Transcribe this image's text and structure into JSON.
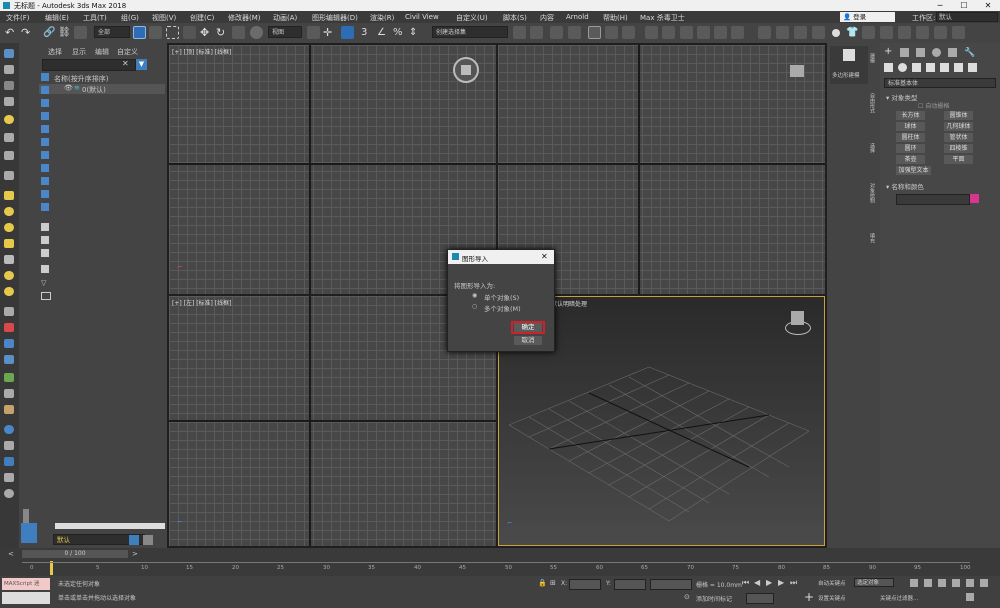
{
  "window": {
    "title": "无标题 - Autodesk 3ds Max 2018",
    "minimize": "─",
    "maximize": "☐",
    "close": "✕"
  },
  "menu": [
    "文件(F)",
    "编辑(E)",
    "工具(T)",
    "组(G)",
    "视图(V)",
    "创建(C)",
    "修改器(M)",
    "动画(A)",
    "图形编辑器(D)",
    "渲染(R)",
    "Civil View",
    "自定义(U)",
    "脚本(S)",
    "内容",
    "Arnold",
    "帮助(H)",
    "Max 杀毒卫士"
  ],
  "account": {
    "login": "登录",
    "workspace_label": "工作区:",
    "workspace_value": "默认"
  },
  "toolbar": {
    "filter_all": "全部",
    "ref_coord": "视图",
    "selection_set": "创建选择集"
  },
  "explorer": {
    "tabs": [
      "选择",
      "显示",
      "编辑",
      "自定义"
    ],
    "column_header": "名称(按升序排序)",
    "root_item": "0(默认)",
    "layer_label": "默认"
  },
  "viewports": {
    "top_left": "[+] [顶] [标准] [线框]",
    "top_right": "",
    "bottom_left": "[+] [左] [标准] [线框]",
    "bottom_right": "默认明暗处理"
  },
  "dialog": {
    "title": "图形导入",
    "close": "✕",
    "group_label": "将图形导入为:",
    "option_single": "单个对象(S)",
    "option_multiple": "多个对象(M)",
    "ok": "确定",
    "cancel": "取消",
    "selected_option": "single"
  },
  "cmdpanel": {
    "preview_label": "多边形建模",
    "dropdown": "标准基本体",
    "section_object_type": "对象类型",
    "autogrid": "自动栅格",
    "buttons": [
      "长方体",
      "圆锥体",
      "球体",
      "几何球体",
      "圆柱体",
      "管状体",
      "圆环",
      "四棱锥",
      "茶壶",
      "平面",
      "加强型文本"
    ],
    "section_name_color": "名称和颜色",
    "object_color": "#d6368e",
    "side_tabs": [
      "建模",
      "自由形式",
      "选择",
      "对象绘制",
      "填充"
    ]
  },
  "timeline": {
    "frame_display": "0 / 100",
    "ticks": [
      "0",
      "5",
      "10",
      "15",
      "20",
      "25",
      "30",
      "35",
      "40",
      "45",
      "50",
      "55",
      "60",
      "65",
      "70",
      "75",
      "80",
      "85",
      "90",
      "95",
      "100"
    ]
  },
  "status": {
    "maxscript": "MAXScript 迷",
    "line1": "未选定任何对象",
    "line2": "单击或单击并拖动以选择对象",
    "x_label": "X:",
    "y_label": "Y:",
    "grid": "栅格 = 10.0mm",
    "add_time_tag": "添加时间标记",
    "auto_key": "自动关键点",
    "selected_object": "选定对象",
    "set_key": "设置关键点",
    "key_filters": "关键点过滤器..."
  },
  "colors": {
    "accent_red": "#d0202a",
    "active_border": "#c9a23a",
    "icon_blue": "#4a86c8"
  }
}
